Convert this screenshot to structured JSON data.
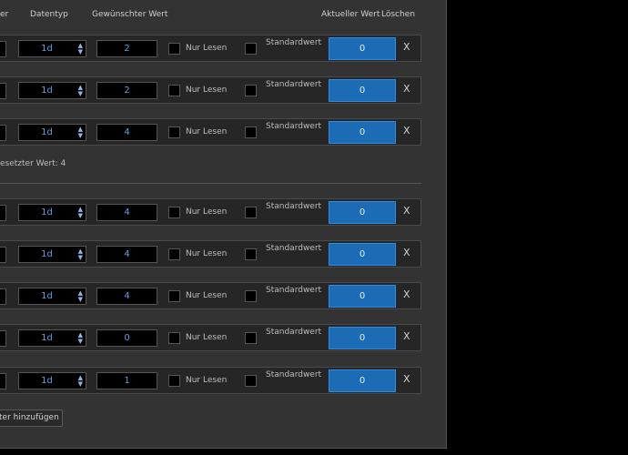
{
  "header": {
    "col_partial": "er",
    "col_type": "Datentyp",
    "col_wanted": "Gewünschter Wert",
    "col_current": "Aktueller Wert",
    "col_delete": "Löschen"
  },
  "labels": {
    "read_only": "Nur Lesen",
    "default_value": "Standardwert",
    "delete": "X"
  },
  "colors": {
    "accent": "#1b6bb5",
    "panel": "#333333",
    "row": "#262626"
  },
  "group1": {
    "rows": [
      {
        "type": "1d",
        "wanted": "2",
        "current": "0"
      },
      {
        "type": "1d",
        "wanted": "2",
        "current": "0"
      },
      {
        "type": "1d",
        "wanted": "4",
        "current": "0"
      }
    ],
    "note": "esetzter Wert: 4"
  },
  "group2": {
    "rows": [
      {
        "type": "1d",
        "wanted": "4",
        "current": "0"
      },
      {
        "type": "1d",
        "wanted": "4",
        "current": "0"
      },
      {
        "type": "1d",
        "wanted": "4",
        "current": "0"
      },
      {
        "type": "1d",
        "wanted": "0",
        "current": "0"
      },
      {
        "type": "1d",
        "wanted": "1",
        "current": "0"
      }
    ]
  },
  "add_button": {
    "label": "ter hinzufügen"
  }
}
